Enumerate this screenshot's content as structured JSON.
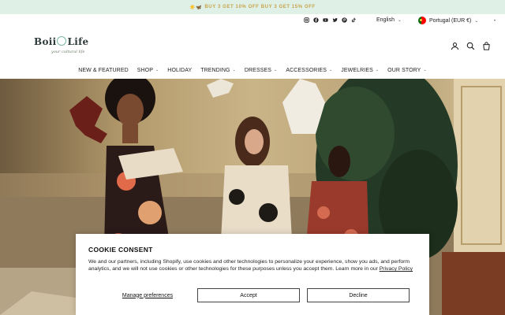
{
  "announcement": {
    "emoji": "☀️🦋",
    "text": "BUY 3 GET 10% OFF BUY 3 GET 15% OFF"
  },
  "utility": {
    "socials": [
      "instagram-icon",
      "facebook-icon",
      "youtube-icon",
      "twitter-icon",
      "pinterest-icon",
      "tiktok-icon"
    ],
    "language": "English",
    "country": "Portugal (EUR €)"
  },
  "header": {
    "logo_left": "Boii",
    "logo_right": "Life",
    "logo_tagline": "your cultural life"
  },
  "nav": {
    "items": [
      {
        "label": "NEW & FEATURED",
        "dropdown": false
      },
      {
        "label": "SHOP",
        "dropdown": true
      },
      {
        "label": "HOLIDAY",
        "dropdown": false
      },
      {
        "label": "TRENDING",
        "dropdown": true
      },
      {
        "label": "DRESSES",
        "dropdown": true
      },
      {
        "label": "ACCESSORIES",
        "dropdown": true
      },
      {
        "label": "JEWELRIES",
        "dropdown": true
      },
      {
        "label": "OUR STORY",
        "dropdown": true
      }
    ]
  },
  "consent": {
    "title": "COOKIE CONSENT",
    "body": "We and our partners, including Shopify, use cookies and other technologies to personalize your experience, show you ads, and perform analytics, and we will not use cookies or other technologies for these purposes unless you accept them. Learn more in our",
    "policy_link": "Privacy Policy",
    "manage_label": "Manage preferences",
    "accept_label": "Accept",
    "decline_label": "Decline"
  },
  "colors": {
    "announce_bg": "#dff1e7",
    "announce_text": "#c9a24a",
    "brand_accent": "#7cb7a5"
  }
}
